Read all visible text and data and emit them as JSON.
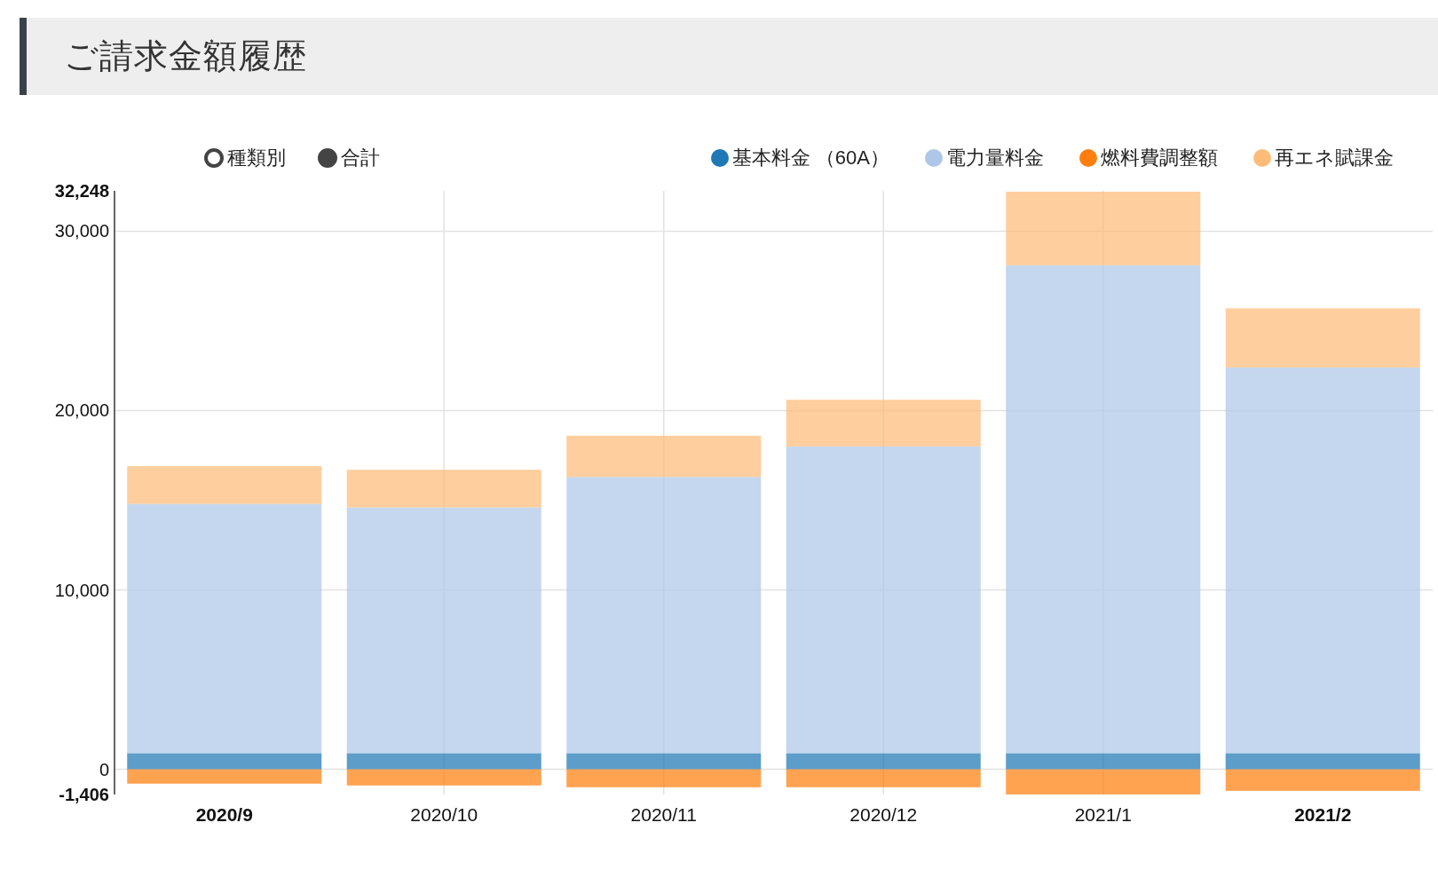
{
  "header": {
    "title": "ご請求金額履歴"
  },
  "view_options": [
    {
      "label": "種類別",
      "selected": true
    },
    {
      "label": "合計",
      "selected": false
    }
  ],
  "chart": {
    "emphasized_categories": [
      true,
      false,
      false,
      false,
      false,
      true
    ],
    "chart_data": {
      "type": "bar",
      "stacked": true,
      "grid": true,
      "categories": [
        "2020/9",
        "2020/10",
        "2020/11",
        "2020/12",
        "2021/1",
        "2021/2"
      ],
      "series": [
        {
          "name": "基本料金 （60A）",
          "color": "#1f77b4",
          "values": [
            900,
            900,
            900,
            900,
            900,
            900
          ]
        },
        {
          "name": "電力量料金",
          "color": "#aec7e8",
          "values": [
            13900,
            13700,
            15400,
            17100,
            27200,
            21500
          ]
        },
        {
          "name": "燃料費調整額",
          "color": "#ff7f0e",
          "values": [
            -800,
            -900,
            -1000,
            -1000,
            -1400,
            -1200
          ]
        },
        {
          "name": "再エネ賦課金",
          "color": "#ffbb78",
          "values": [
            2100,
            2100,
            2300,
            2600,
            4100,
            3300
          ]
        }
      ],
      "ylim": [
        -1406,
        32248
      ],
      "yticks": [
        {
          "value": -1406,
          "label": "-1,406"
        },
        {
          "value": 0,
          "label": "0"
        },
        {
          "value": 10000,
          "label": "10,000"
        },
        {
          "value": 20000,
          "label": "20,000"
        },
        {
          "value": 30000,
          "label": "30,000"
        },
        {
          "value": 32248,
          "label": "32,248"
        }
      ]
    }
  }
}
